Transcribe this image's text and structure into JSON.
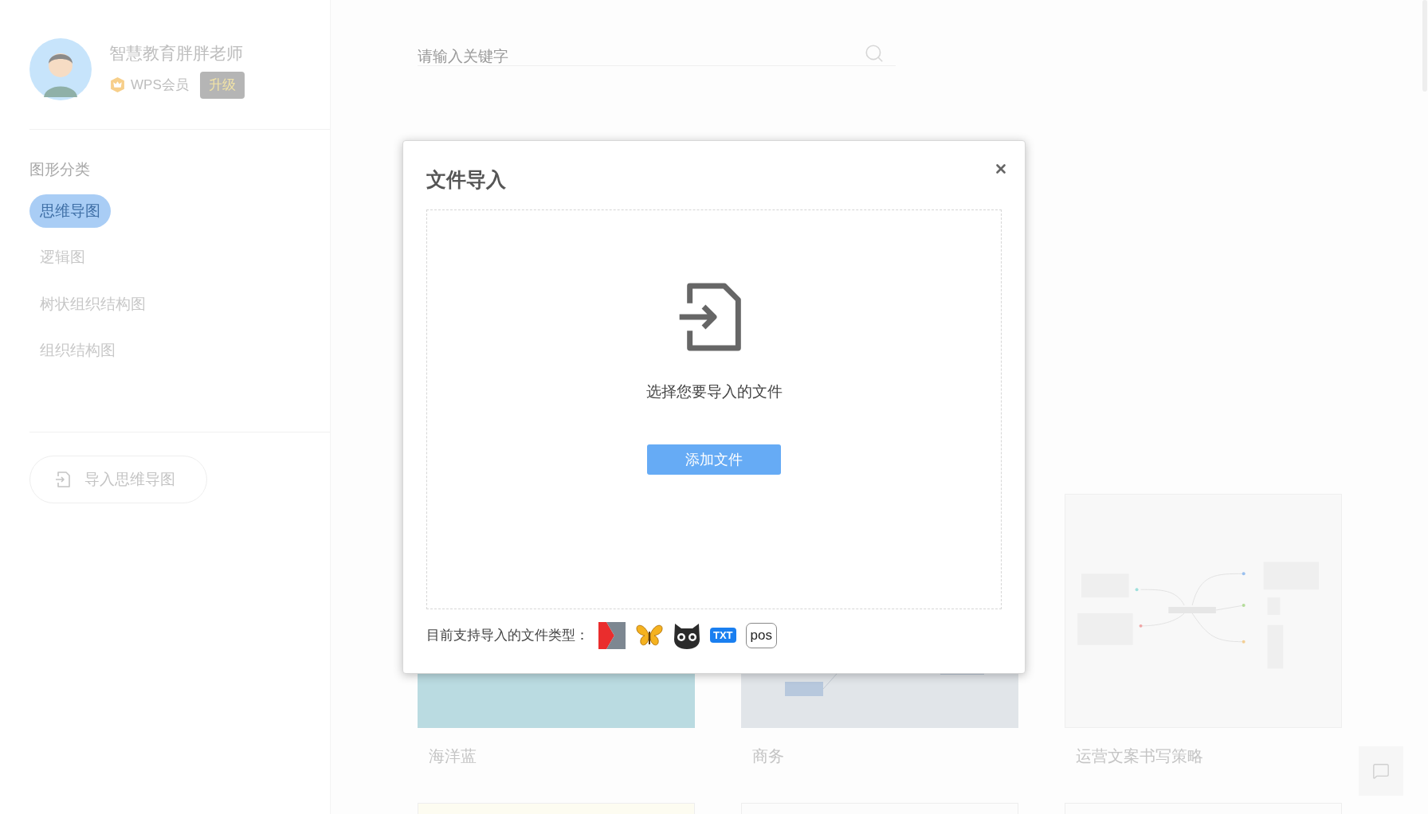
{
  "sidebar": {
    "user": {
      "name": "智慧教育胖胖老师",
      "membership": "WPS会员",
      "upgrade_button": "升级"
    },
    "category_heading": "图形分类",
    "categories": [
      {
        "label": "思维导图",
        "selected": true
      },
      {
        "label": "逻辑图",
        "selected": false
      },
      {
        "label": "树状组织结构图",
        "selected": false
      },
      {
        "label": "组织结构图",
        "selected": false
      }
    ],
    "import_button": "导入思维导图"
  },
  "search": {
    "placeholder": "请输入关键字"
  },
  "templates": [
    {
      "kind": "ocean",
      "name": "海洋蓝"
    },
    {
      "kind": "business",
      "name": "商务"
    },
    {
      "kind": "mindmap",
      "name": "运营文案书写策略"
    },
    {
      "kind": "cream"
    },
    {
      "kind": "plain"
    },
    {
      "kind": "plain"
    }
  ],
  "dialog": {
    "title": "文件导入",
    "prompt": "选择您要导入的文件",
    "add_button": "添加文件",
    "supported_label": "目前支持导入的文件类型：",
    "file_types": [
      {
        "kind": "mindmanager"
      },
      {
        "kind": "butterfly"
      },
      {
        "kind": "owl"
      },
      {
        "kind": "txt",
        "label": "TXT"
      },
      {
        "kind": "pos",
        "label": "pos"
      }
    ]
  }
}
